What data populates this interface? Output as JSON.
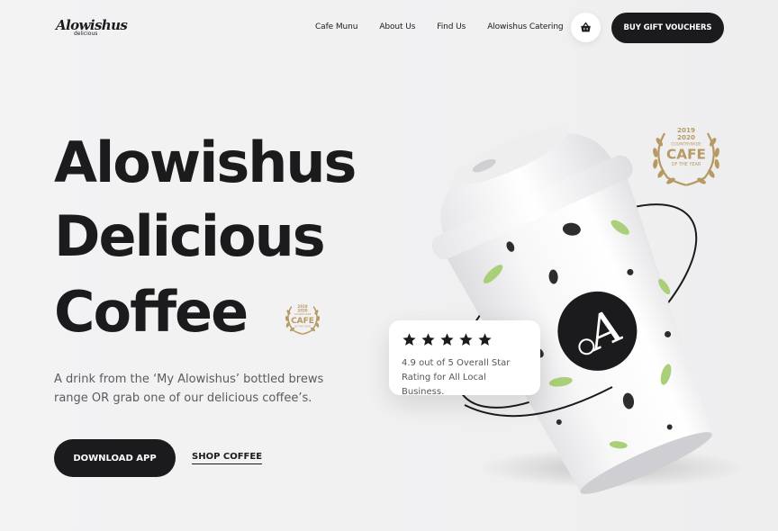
{
  "brand": {
    "logo_script": "Alowishus",
    "logo_sub": "delicious"
  },
  "nav": {
    "items": [
      {
        "label": "Cafe Munu"
      },
      {
        "label": "About Us"
      },
      {
        "label": "Find Us"
      },
      {
        "label": "Alowishus Catering"
      }
    ],
    "cart_icon": "basket-icon",
    "gift_button": "BUY GIFT VOUCHERS"
  },
  "hero": {
    "title_line1": "Alowishus",
    "title_line2": "Delicious",
    "title_line3": "Coffee",
    "description": "A drink from the ‘My Alowishus’ bottled brews range OR grab one of our delicious coffee’s.",
    "download_button": "DOWNLOAD APP",
    "shop_link": "SHOP COFFEE"
  },
  "award": {
    "year1": "2019",
    "year2": "2020",
    "region": "COUNTRYWIDE",
    "title": "CAFE",
    "subtitle": "OF THE YEAR",
    "color": "#b79a63"
  },
  "rating": {
    "stars": 5,
    "text": "4.9 out of 5 Overall Star Rating for All Local Business."
  },
  "cup": {
    "monogram": "A",
    "leaf_color": "#a9cf78",
    "dot_color": "#2d2d30"
  },
  "colors": {
    "primary": "#1b1b1d",
    "background": "#f0f0f1",
    "gold": "#b79a63"
  }
}
